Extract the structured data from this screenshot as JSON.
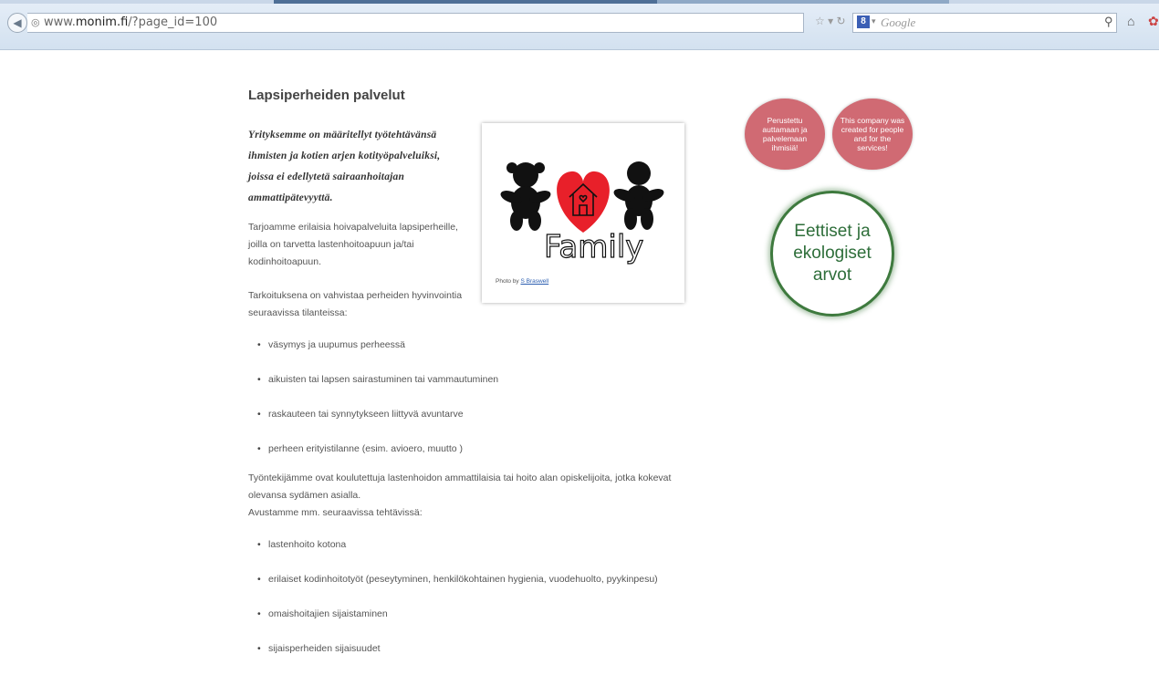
{
  "browser": {
    "url_prefix": "www.",
    "url_domain": "monim.fi",
    "url_path": "/?page_id=100",
    "search_placeholder": "Google"
  },
  "page": {
    "title": "Lapsiperheiden palvelut",
    "intro": "Yrityksemme on määritellyt työtehtävänsä ihmisten ja kotien arjen kotityöpalveluiksi, joissa ei edellytetä sairaanhoitajan ammattipätevyyttä.",
    "paragraph1": "Tarjoamme erilaisia hoivapalveluita lapsiperheille, joilla on tarvetta lastenhoitoapuun ja/tai kodinhoitoapuun.",
    "paragraph2": "Tarkoituksena on vahvistaa perheiden hyvinvointia seuraavissa tilanteissa:",
    "situations": [
      "väsymys ja uupumus perheessä",
      "aikuisten tai lapsen sairastuminen tai vammautuminen",
      "raskauteen tai synnytykseen liittyvä avuntarve",
      "perheen erityistilanne (esim. avioero, muutto )"
    ],
    "paragraph3_line1": "Työntekijämme ovat koulutettuja lastenhoidon ammattilaisia tai hoito alan opiskelijoita, jotka kokevat olevansa sydämen asialla.",
    "paragraph3_line2": "Avustamme mm. seuraavissa tehtävissä:",
    "tasks": [
      "lastenhoito kotona",
      "erilaiset kodinhoitotyöt (peseytyminen, henkilökohtainen hygienia, vuodehuolto, pyykinpesu)",
      "omaishoitajien sijaistaminen",
      "sijaisperheiden sijaisuudet"
    ],
    "image_word": "Family",
    "photo_by": "Photo by ",
    "photo_credit": "S Braswell"
  },
  "sidebar": {
    "circle_fi": "Perustettu auttamaan ja palvelemaan ihmisiä!",
    "circle_en": "This company was created for people and for the services!",
    "values_badge": "Eettiset ja ekologiset arvot"
  },
  "colors": {
    "pink": "#d06a73",
    "green": "#2e6e3a",
    "heart": "#e8202a"
  }
}
